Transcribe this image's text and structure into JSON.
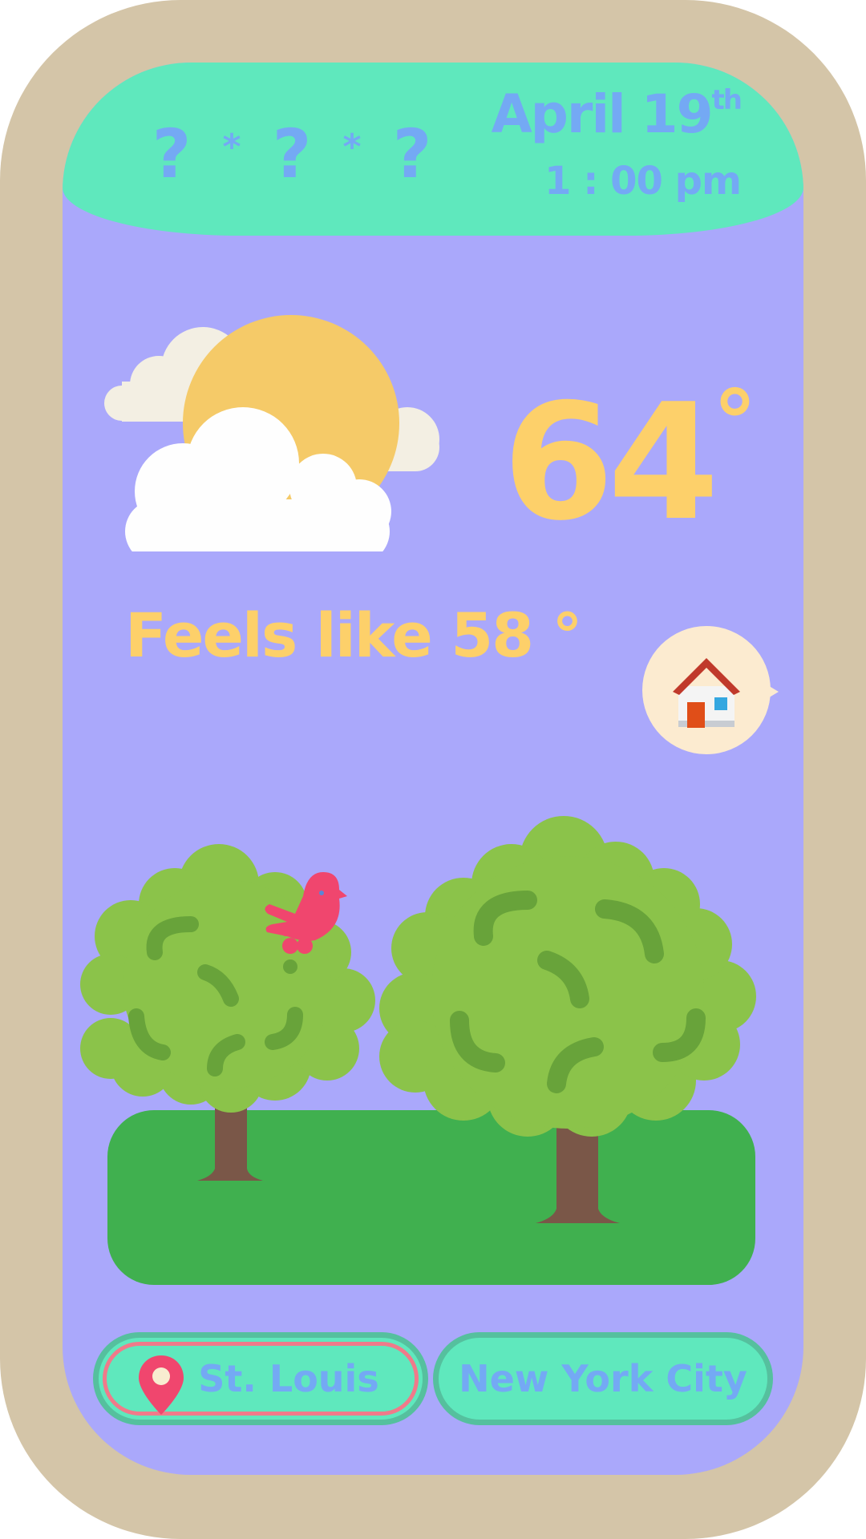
{
  "header": {
    "symbols": [
      "?",
      "*",
      "?",
      "*",
      "?"
    ],
    "date": "April 19",
    "date_suffix": "th",
    "time": "1 : 00 pm"
  },
  "weather": {
    "icon": "partly-cloudy-icon",
    "temperature": "64",
    "degree": "°",
    "feels_like": "Feels like 58 °"
  },
  "home": {
    "icon": "house-icon"
  },
  "scene": {
    "elements": [
      "tree-icon",
      "bird-icon",
      "tree-icon",
      "grass"
    ]
  },
  "locations": [
    {
      "label": "St. Louis",
      "icon": "location-pin-icon",
      "selected": true
    },
    {
      "label": "New York City",
      "selected": false
    }
  ],
  "colors": {
    "frame": "#d4c5a8",
    "background": "#aaa8fb",
    "header": "#5fe8bd",
    "text_blue": "#74a9f4",
    "text_yellow": "#fdd06a",
    "grass": "#40b04f",
    "tree": "#8bc34a",
    "bird": "#f0466e"
  }
}
